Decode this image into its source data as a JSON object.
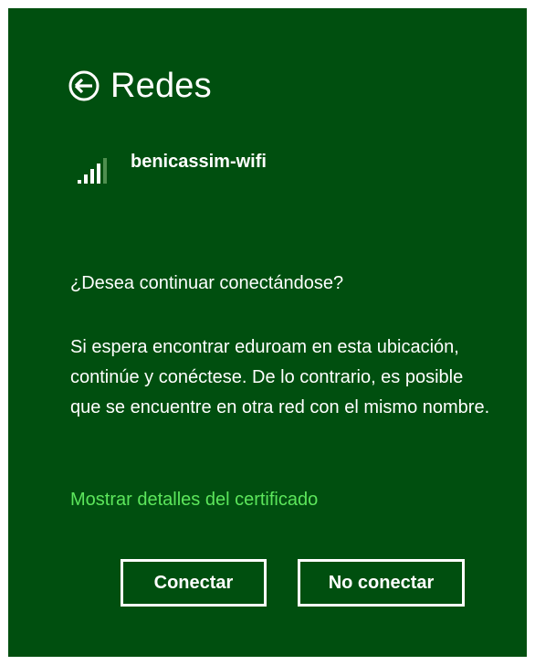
{
  "header": {
    "title": "Redes",
    "back_icon": "back-arrow-circle-icon"
  },
  "network": {
    "signal_icon": "wifi-signal-bars-icon",
    "signal_level": 0.8,
    "name": "benicassim-wifi"
  },
  "prompt": {
    "question": "¿Desea continuar conectándose?",
    "description": "Si espera encontrar eduroam en esta ubicación, continúe y conéctese. De lo contrario, es posible que se encuentre en otra red con el mismo nombre."
  },
  "certificate_link": "Mostrar detalles del certificado",
  "buttons": {
    "connect": "Conectar",
    "no_connect": "No conectar"
  },
  "colors": {
    "background": "#004f0f",
    "text": "#ffffff",
    "link": "#5ce65c"
  }
}
